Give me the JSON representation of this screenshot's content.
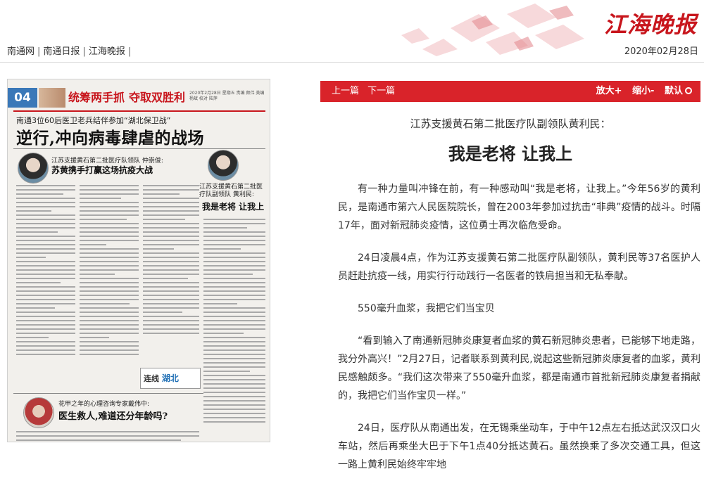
{
  "header": {
    "logo_text": "江海晚报",
    "site_links": [
      "南通网",
      "南通日报",
      "江海晚报"
    ],
    "date": "2020年02月28日"
  },
  "paper": {
    "page_number": "04",
    "band_title": "统筹两手抓",
    "band_title2": "夺取双胜利",
    "meta_text": "2020年2月28日 星期五 责编 颜伟 美编 杨斌 校对 陆萍",
    "kicker": "南通3位60后医卫老兵结伴参加“湖北保卫战”",
    "headline": "逆行,冲向病毒肆虐的战场",
    "story1_kicker": "江苏支援黄石第二批医疗队领队 仲崇俊:",
    "story1_title": "苏黄携手打赢这场抗疫大战",
    "story2_kicker": "江苏支援黄石第二批医疗队副领队 黄利民:",
    "story2_title": "我是老将 让我上",
    "lianxian_a": "连线",
    "lianxian_b": "湖北",
    "story3_kicker": "花甲之年的心理咨询专家戴伟中:",
    "story3_title": "医生救人,难道还分年龄吗?"
  },
  "toolbar": {
    "prev": "上一篇",
    "next": "下一篇",
    "font_bigger": "放大+",
    "font_smaller": "缩小-",
    "font_default": "默认"
  },
  "article": {
    "subtitle": "江苏支援黄石第二批医疗队副领队黄利民：",
    "title": "我是老将 让我上",
    "paragraphs": [
      "有一种力量叫冲锋在前，有一种感动叫“我是老将，让我上。”今年56岁的黄利民，是南通市第六人民医院院长，曾在2003年参加过抗击“非典”疫情的战斗。时隔17年，面对新冠肺炎疫情，这位勇士再次临危受命。",
      "24日凌晨4点，作为江苏支援黄石第二批医疗队副领队，黄利民等37名医护人员赶赴抗疫一线，用实行行动践行一名医者的铁肩担当和无私奉献。",
      "550毫升血浆，我把它们当宝贝",
      "“看到输入了南通新冠肺炎康复者血浆的黄石新冠肺炎患者，已能够下地走路，我分外高兴！”2月27日，记者联系到黄利民,说起这些新冠肺炎康复者的血浆，黄利民感触颇多。“我们这次带来了550毫升血浆，都是南通市首批新冠肺炎康复者捐献的，我把它们当作宝贝一样。”",
      "24日，医疗队从南通出发，在无锡乘坐动车，于中午12点左右抵达武汉汉口火车站，然后再乘坐大巴于下午1点40分抵达黄石。虽然换乘了多次交通工具，但这一路上黄利民始终牢牢地"
    ]
  },
  "colors": {
    "brand_red": "#d9232a",
    "logo_red": "#c8161d"
  }
}
